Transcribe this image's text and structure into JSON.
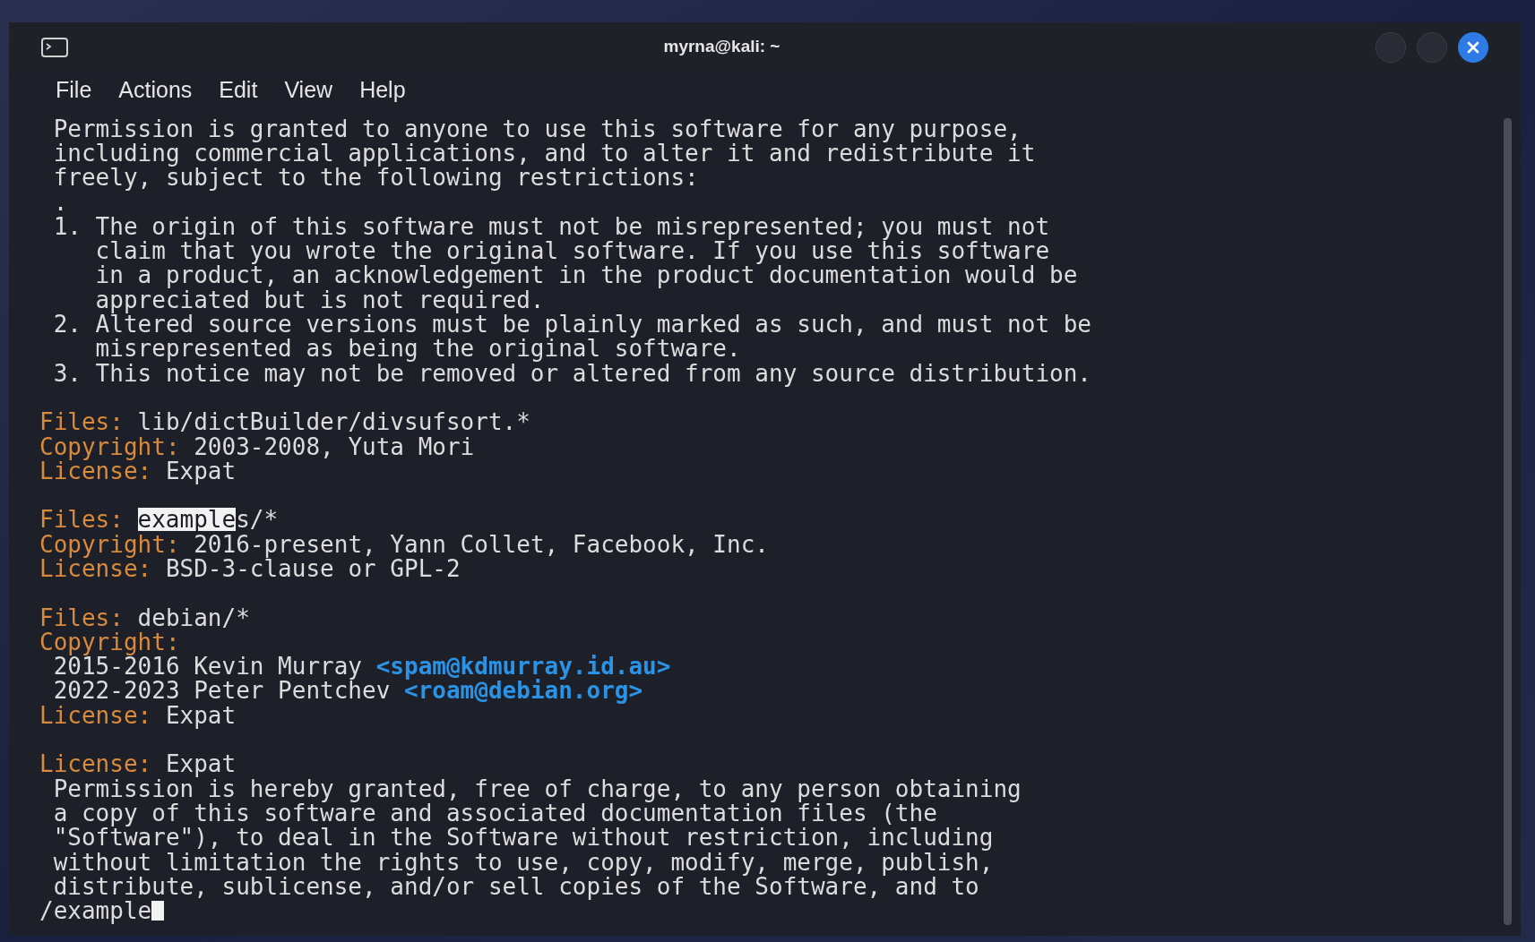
{
  "window": {
    "title": "myrna@kali: ~"
  },
  "menu": [
    "File",
    "Actions",
    "Edit",
    "View",
    "Help"
  ],
  "lines": [
    {
      "kind": "text",
      "spans": [
        {
          "kind": "text",
          "text": " Permission is granted to anyone to use this software for any purpose,"
        }
      ]
    },
    {
      "kind": "text",
      "spans": [
        {
          "kind": "text",
          "text": " including commercial applications, and to alter it and redistribute it"
        }
      ]
    },
    {
      "kind": "text",
      "spans": [
        {
          "kind": "text",
          "text": " freely, subject to the following restrictions:"
        }
      ]
    },
    {
      "kind": "text",
      "spans": [
        {
          "kind": "text",
          "text": " ."
        }
      ]
    },
    {
      "kind": "text",
      "spans": [
        {
          "kind": "text",
          "text": " 1. The origin of this software must not be misrepresented; you must not"
        }
      ]
    },
    {
      "kind": "text",
      "spans": [
        {
          "kind": "text",
          "text": "    claim that you wrote the original software. If you use this software"
        }
      ]
    },
    {
      "kind": "text",
      "spans": [
        {
          "kind": "text",
          "text": "    in a product, an acknowledgement in the product documentation would be"
        }
      ]
    },
    {
      "kind": "text",
      "spans": [
        {
          "kind": "text",
          "text": "    appreciated but is not required."
        }
      ]
    },
    {
      "kind": "text",
      "spans": [
        {
          "kind": "text",
          "text": " 2. Altered source versions must be plainly marked as such, and must not be"
        }
      ]
    },
    {
      "kind": "text",
      "spans": [
        {
          "kind": "text",
          "text": "    misrepresented as being the original software."
        }
      ]
    },
    {
      "kind": "text",
      "spans": [
        {
          "kind": "text",
          "text": " 3. This notice may not be removed or altered from any source distribution."
        }
      ]
    },
    {
      "kind": "blank"
    },
    {
      "kind": "text",
      "spans": [
        {
          "kind": "key",
          "text": "Files:"
        },
        {
          "kind": "text",
          "text": " lib/dictBuilder/divsufsort.*"
        }
      ]
    },
    {
      "kind": "text",
      "spans": [
        {
          "kind": "key",
          "text": "Copyright:"
        },
        {
          "kind": "text",
          "text": " 2003-2008, Yuta Mori"
        }
      ]
    },
    {
      "kind": "text",
      "spans": [
        {
          "kind": "key",
          "text": "License:"
        },
        {
          "kind": "text",
          "text": " Expat"
        }
      ]
    },
    {
      "kind": "blank"
    },
    {
      "kind": "text",
      "spans": [
        {
          "kind": "key",
          "text": "Files:"
        },
        {
          "kind": "match",
          "text": "example"
        },
        {
          "kind": "text",
          "text": "s/*"
        }
      ]
    },
    {
      "kind": "text",
      "spans": [
        {
          "kind": "key",
          "text": "Copyright:"
        },
        {
          "kind": "text",
          "text": " 2016-present, Yann Collet, Facebook, Inc."
        }
      ]
    },
    {
      "kind": "text",
      "spans": [
        {
          "kind": "key",
          "text": "License:"
        },
        {
          "kind": "text",
          "text": " BSD-3-clause or GPL-2"
        }
      ]
    },
    {
      "kind": "blank"
    },
    {
      "kind": "text",
      "spans": [
        {
          "kind": "key",
          "text": "Files:"
        },
        {
          "kind": "text",
          "text": " debian/*"
        }
      ]
    },
    {
      "kind": "text",
      "spans": [
        {
          "kind": "key",
          "text": "Copyright:"
        }
      ]
    },
    {
      "kind": "text",
      "spans": [
        {
          "kind": "text",
          "text": " 2015-2016 Kevin Murray "
        },
        {
          "kind": "email",
          "text": "<spam@kdmurray.id.au>"
        }
      ]
    },
    {
      "kind": "text",
      "spans": [
        {
          "kind": "text",
          "text": " 2022-2023 Peter Pentchev "
        },
        {
          "kind": "email",
          "text": "<roam@debian.org>"
        }
      ]
    },
    {
      "kind": "text",
      "spans": [
        {
          "kind": "key",
          "text": "License:"
        },
        {
          "kind": "text",
          "text": " Expat"
        }
      ]
    },
    {
      "kind": "blank"
    },
    {
      "kind": "text",
      "spans": [
        {
          "kind": "key",
          "text": "License:"
        },
        {
          "kind": "text",
          "text": " Expat"
        }
      ]
    },
    {
      "kind": "text",
      "spans": [
        {
          "kind": "text",
          "text": " Permission is hereby granted, free of charge, to any person obtaining"
        }
      ]
    },
    {
      "kind": "text",
      "spans": [
        {
          "kind": "text",
          "text": " a copy of this software and associated documentation files (the"
        }
      ]
    },
    {
      "kind": "text",
      "spans": [
        {
          "kind": "text",
          "text": " \"Software\"), to deal in the Software without restriction, including"
        }
      ]
    },
    {
      "kind": "text",
      "spans": [
        {
          "kind": "text",
          "text": " without limitation the rights to use, copy, modify, merge, publish,"
        }
      ]
    },
    {
      "kind": "text",
      "spans": [
        {
          "kind": "text",
          "text": " distribute, sublicense, and/or sell copies of the Software, and to"
        }
      ]
    },
    {
      "kind": "prompt",
      "spans": [
        {
          "kind": "text",
          "text": "/example"
        }
      ]
    }
  ]
}
